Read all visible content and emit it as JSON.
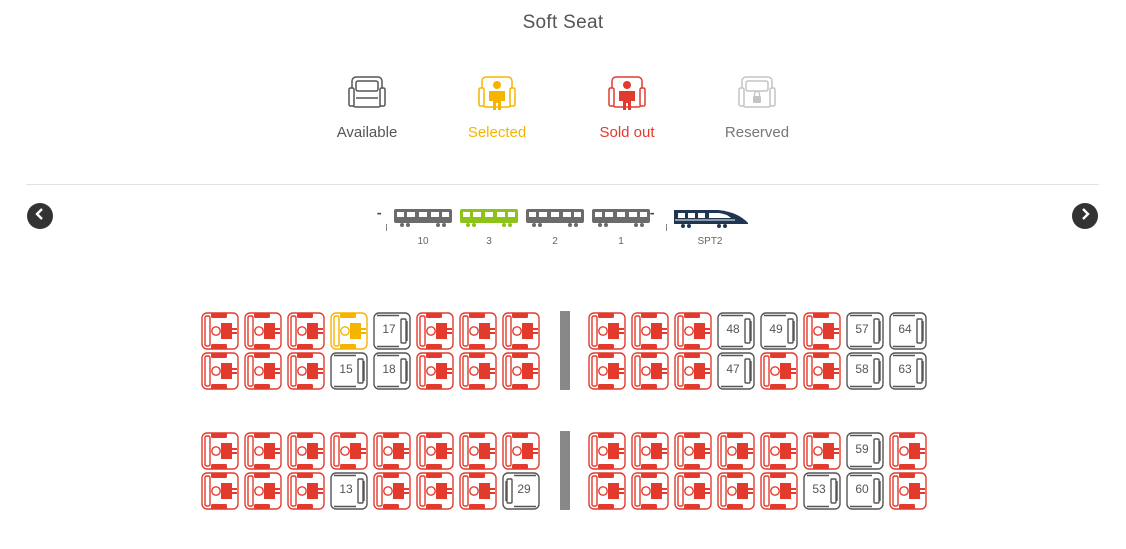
{
  "header": {
    "title": "Soft Seat"
  },
  "legend": [
    {
      "label": "Available",
      "state": "available",
      "color": "#555555"
    },
    {
      "label": "Selected",
      "state": "selected",
      "color": "#f5b400"
    },
    {
      "label": "Sold out",
      "state": "sold",
      "color": "#e23b2e"
    },
    {
      "label": "Reserved",
      "state": "reserved",
      "color": "#b8b8b8"
    }
  ],
  "train": {
    "cars": [
      {
        "label": "10",
        "selected": false
      },
      {
        "label": "3",
        "selected": true
      },
      {
        "label": "2",
        "selected": false
      },
      {
        "label": "1",
        "selected": false
      }
    ],
    "locomotive": "SPT2",
    "selected_color": "#8cc21a",
    "car_color": "#6b6b6b",
    "loco_color": "#1f3550"
  },
  "seat_rows": [
    {
      "rowIndex": 0,
      "left": [
        {
          "s": "sold"
        },
        {
          "s": "sold"
        },
        {
          "s": "sold"
        },
        {
          "s": "selected"
        },
        {
          "s": "available",
          "n": "17"
        },
        {
          "s": "sold"
        },
        {
          "s": "sold"
        },
        {
          "s": "sold"
        }
      ],
      "right": [
        {
          "s": "sold"
        },
        {
          "s": "sold"
        },
        {
          "s": "sold"
        },
        {
          "s": "available",
          "n": "48"
        },
        {
          "s": "available",
          "n": "49"
        },
        {
          "s": "sold"
        },
        {
          "s": "available",
          "n": "57"
        },
        {
          "s": "available",
          "n": "64"
        }
      ]
    },
    {
      "rowIndex": 1,
      "left": [
        {
          "s": "sold"
        },
        {
          "s": "sold"
        },
        {
          "s": "sold"
        },
        {
          "s": "available",
          "n": "15"
        },
        {
          "s": "available",
          "n": "18"
        },
        {
          "s": "sold"
        },
        {
          "s": "sold"
        },
        {
          "s": "sold"
        }
      ],
      "right": [
        {
          "s": "sold"
        },
        {
          "s": "sold"
        },
        {
          "s": "sold"
        },
        {
          "s": "available",
          "n": "47"
        },
        {
          "s": "sold"
        },
        {
          "s": "sold"
        },
        {
          "s": "available",
          "n": "58"
        },
        {
          "s": "available",
          "n": "63"
        }
      ]
    },
    {
      "rowIndex": 2,
      "left": [
        {
          "s": "sold"
        },
        {
          "s": "sold"
        },
        {
          "s": "sold"
        },
        {
          "s": "sold"
        },
        {
          "s": "sold"
        },
        {
          "s": "sold"
        },
        {
          "s": "sold"
        },
        {
          "s": "sold"
        }
      ],
      "right": [
        {
          "s": "sold"
        },
        {
          "s": "sold"
        },
        {
          "s": "sold"
        },
        {
          "s": "sold"
        },
        {
          "s": "sold"
        },
        {
          "s": "sold"
        },
        {
          "s": "available",
          "n": "59"
        },
        {
          "s": "sold"
        }
      ]
    },
    {
      "rowIndex": 3,
      "left": [
        {
          "s": "sold"
        },
        {
          "s": "sold"
        },
        {
          "s": "sold"
        },
        {
          "s": "available",
          "n": "13"
        },
        {
          "s": "sold"
        },
        {
          "s": "sold"
        },
        {
          "s": "sold"
        },
        {
          "s": "available",
          "n": "29",
          "flip": true
        }
      ],
      "right": [
        {
          "s": "sold"
        },
        {
          "s": "sold"
        },
        {
          "s": "sold"
        },
        {
          "s": "sold"
        },
        {
          "s": "sold"
        },
        {
          "s": "available",
          "n": "53"
        },
        {
          "s": "available",
          "n": "60"
        },
        {
          "s": "sold"
        }
      ]
    }
  ],
  "colors": {
    "available": "#555555",
    "selected": "#f5b400",
    "sold": "#e23b2e",
    "reserved": "#b8b8b8"
  }
}
